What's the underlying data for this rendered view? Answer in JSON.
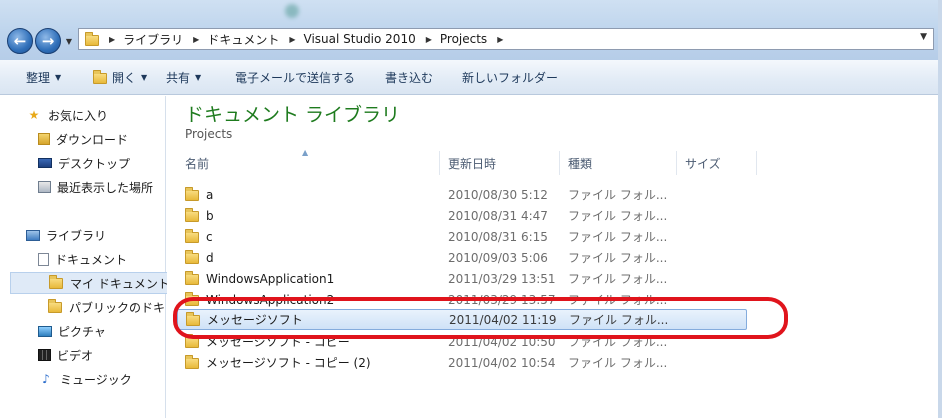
{
  "address": {
    "crumbs": [
      "ライブラリ",
      "ドキュメント",
      "Visual Studio 2010",
      "Projects"
    ]
  },
  "toolbar": {
    "organize": "整理",
    "open": "開く",
    "share": "共有",
    "email": "電子メールで送信する",
    "burn": "書き込む",
    "new_folder": "新しいフォルダー"
  },
  "sidebar": {
    "items": [
      {
        "label": "お気に入り",
        "icon": "star-icon"
      },
      {
        "label": "ダウンロード",
        "icon": "download-folder-icon"
      },
      {
        "label": "デスクトップ",
        "icon": "desktop-icon"
      },
      {
        "label": "最近表示した場所",
        "icon": "recent-places-icon"
      },
      {
        "label": "ライブラリ",
        "icon": "library-icon"
      },
      {
        "label": "ドキュメント",
        "icon": "documents-icon"
      },
      {
        "label": "マイ ドキュメント",
        "icon": "folder-icon"
      },
      {
        "label": "パブリックのドキ",
        "icon": "folder-icon"
      },
      {
        "label": "ピクチャ",
        "icon": "pictures-icon"
      },
      {
        "label": "ビデオ",
        "icon": "video-icon"
      },
      {
        "label": "ミュージック",
        "icon": "music-icon"
      }
    ]
  },
  "main": {
    "title": "ドキュメント ライブラリ",
    "subtitle": "Projects",
    "columns": {
      "name": "名前",
      "date": "更新日時",
      "type": "種類",
      "size": "サイズ"
    },
    "rows": [
      {
        "name": "a",
        "date": "2010/08/30 5:12",
        "type": "ファイル フォル..."
      },
      {
        "name": "b",
        "date": "2010/08/31 4:47",
        "type": "ファイル フォル..."
      },
      {
        "name": "c",
        "date": "2010/08/31 6:15",
        "type": "ファイル フォル..."
      },
      {
        "name": "d",
        "date": "2010/09/03 5:06",
        "type": "ファイル フォル..."
      },
      {
        "name": "WindowsApplication1",
        "date": "2011/03/29 13:51",
        "type": "ファイル フォル..."
      },
      {
        "name": "WindowsApplication2",
        "date": "2011/03/29 13:57",
        "type": "ファイル フォル..."
      },
      {
        "name": "メッセージソフト",
        "date": "2011/04/02 11:19",
        "type": "ファイル フォル..."
      },
      {
        "name": "メッセージソフト - コピー",
        "date": "2011/04/02 10:50",
        "type": "ファイル フォル..."
      },
      {
        "name": "メッセージソフト - コピー (2)",
        "date": "2011/04/02 10:54",
        "type": "ファイル フォル..."
      }
    ]
  },
  "colors": {
    "title_green": "#1e7b1e",
    "highlight_red": "#e0141c",
    "selection_blue": "#cfe2f7"
  }
}
